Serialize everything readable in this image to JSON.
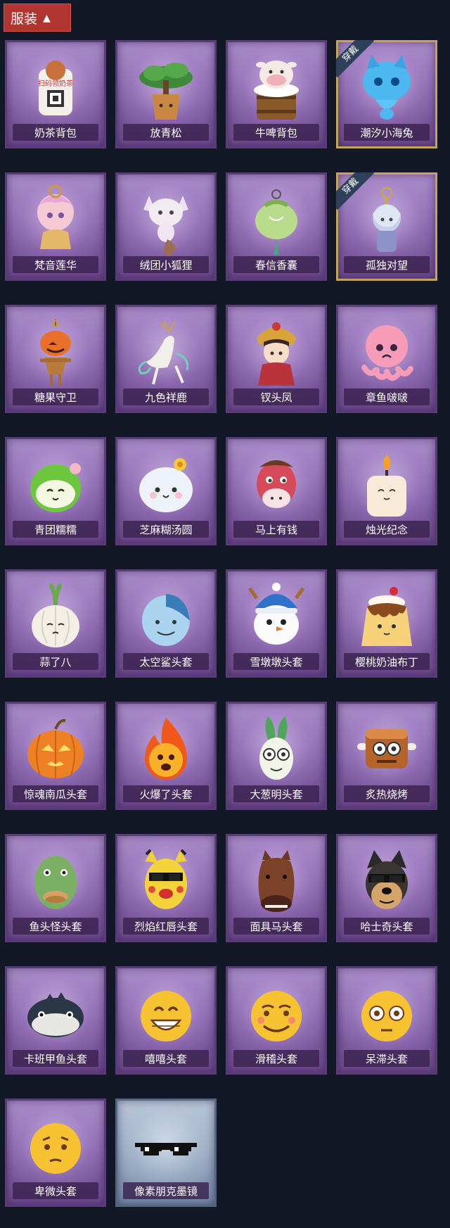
{
  "header": {
    "title": "服装",
    "chevron_icon": "chevron-up-icon",
    "color": "#b03530"
  },
  "equip_badge_label": "穿戴",
  "items": [
    {
      "name": "奶茶背包",
      "icon": "milk-tea-backpack-icon",
      "equipped": false,
      "art_text": "扫码领奶茶"
    },
    {
      "name": "放青松",
      "icon": "bonsai-pine-icon",
      "equipped": false
    },
    {
      "name": "牛啤背包",
      "icon": "cow-beer-backpack-icon",
      "equipped": false
    },
    {
      "name": "潮汐小海兔",
      "icon": "blue-sea-bunny-icon",
      "equipped": true
    },
    {
      "name": "梵音莲华",
      "icon": "lotus-girl-icon",
      "equipped": false
    },
    {
      "name": "绒团小狐狸",
      "icon": "fox-plush-icon",
      "equipped": false
    },
    {
      "name": "春信香囊",
      "icon": "sachet-icon",
      "equipped": false
    },
    {
      "name": "孤独对望",
      "icon": "keychain-figure-icon",
      "equipped": true
    },
    {
      "name": "糖果守卫",
      "icon": "pumpkin-scarecrow-icon",
      "equipped": false
    },
    {
      "name": "九色祥鹿",
      "icon": "deer-icon",
      "equipped": false
    },
    {
      "name": "钗头凤",
      "icon": "phoenix-crown-girl-icon",
      "equipped": false
    },
    {
      "name": "章鱼啵啵",
      "icon": "pink-octopus-icon",
      "equipped": false
    },
    {
      "name": "青团糯糯",
      "icon": "green-dumpling-icon",
      "equipped": false
    },
    {
      "name": "芝麻糊汤圆",
      "icon": "white-dumpling-icon",
      "equipped": false
    },
    {
      "name": "马上有钱",
      "icon": "red-horse-icon",
      "equipped": false
    },
    {
      "name": "烛光纪念",
      "icon": "candle-icon",
      "equipped": false
    },
    {
      "name": "蒜了八",
      "icon": "garlic-icon",
      "equipped": false
    },
    {
      "name": "太空鲨头套",
      "icon": "shark-helmet-icon",
      "equipped": false
    },
    {
      "name": "雪墩墩头套",
      "icon": "snowman-helmet-icon",
      "equipped": false
    },
    {
      "name": "樱桃奶油布丁",
      "icon": "pudding-icon",
      "equipped": false
    },
    {
      "name": "惊魂南瓜头套",
      "icon": "jack-o-lantern-icon",
      "equipped": false
    },
    {
      "name": "火爆了头套",
      "icon": "fire-head-icon",
      "equipped": false
    },
    {
      "name": "大葱明头套",
      "icon": "scallion-head-icon",
      "equipped": false
    },
    {
      "name": "炙热烧烤",
      "icon": "barbecue-meat-icon",
      "equipped": false
    },
    {
      "name": "鱼头怪头套",
      "icon": "fish-head-icon",
      "equipped": false
    },
    {
      "name": "烈焰红唇头套",
      "icon": "yellow-mouse-sunglasses-icon",
      "equipped": false
    },
    {
      "name": "面具马头套",
      "icon": "horse-mask-icon",
      "equipped": false
    },
    {
      "name": "哈士奇头套",
      "icon": "husky-sunglasses-icon",
      "equipped": false
    },
    {
      "name": "卡班甲鱼头套",
      "icon": "pufferfish-icon",
      "equipped": false
    },
    {
      "name": "嘻嘻头套",
      "icon": "grin-emoji-icon",
      "equipped": false
    },
    {
      "name": "滑稽头套",
      "icon": "smirk-emoji-icon",
      "equipped": false
    },
    {
      "name": "呆滞头套",
      "icon": "stunned-emoji-icon",
      "equipped": false
    },
    {
      "name": "卑微头套",
      "icon": "humble-emoji-icon",
      "equipped": false
    },
    {
      "name": "像素朋克墨镜",
      "icon": "pixel-sunglasses-icon",
      "equipped": false,
      "special": true
    }
  ]
}
